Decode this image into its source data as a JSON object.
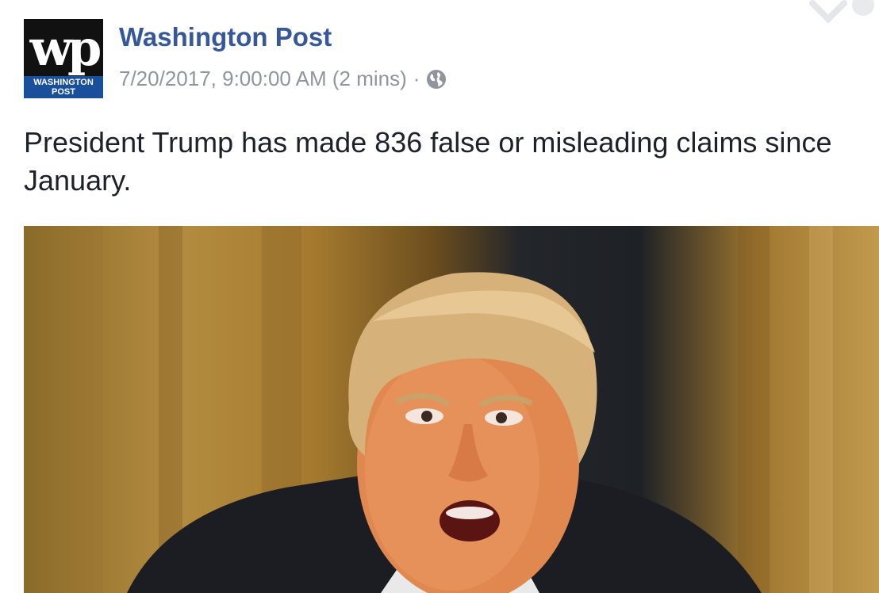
{
  "post": {
    "page_name": "Washington Post",
    "avatar": {
      "monogram": "wp",
      "band_line1": "WASHINGTON",
      "band_line2": "POST"
    },
    "timestamp": "7/20/2017, 9:00:00 AM (2 mins)",
    "separator": "·",
    "privacy_icon": "globe-icon",
    "options_icon": "chevron-down-icon",
    "text": "President Trump has made 836 false or misleading claims since January.",
    "image_description": "photo"
  },
  "colors": {
    "page_name": "#365899",
    "meta": "#90949c",
    "text": "#1d2129",
    "avatar_band": "#1a4f9c"
  }
}
